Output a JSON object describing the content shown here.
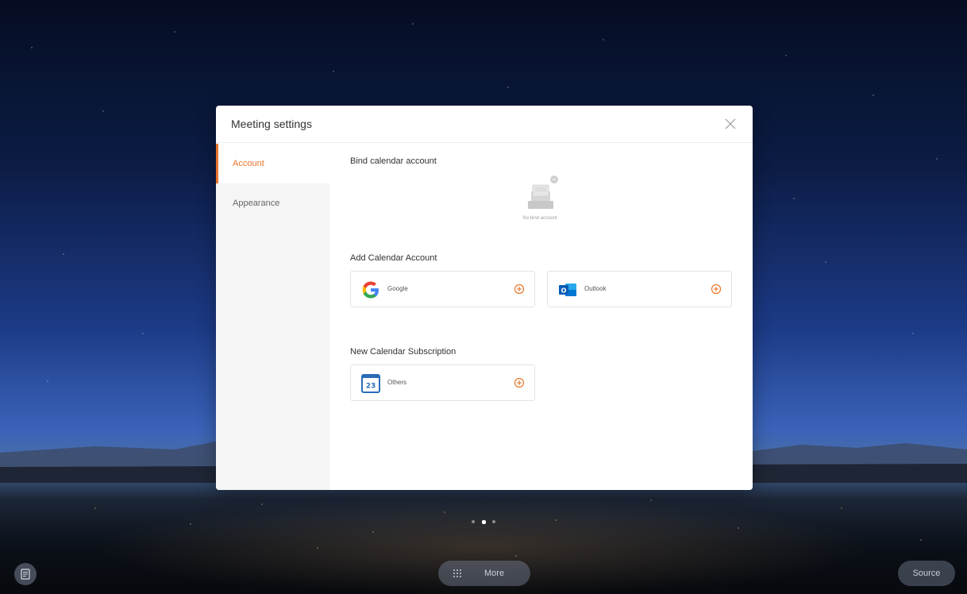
{
  "dialog": {
    "title": "Meeting settings"
  },
  "sidebar": {
    "items": [
      {
        "label": "Account",
        "active": true
      },
      {
        "label": "Appearance",
        "active": false
      }
    ]
  },
  "content": {
    "bind_title": "Bind calendar account",
    "empty_caption": "No bind account",
    "add_title": "Add Calendar Account",
    "accounts": [
      {
        "label": "Google",
        "icon": "google-logo-icon"
      },
      {
        "label": "Outlook",
        "icon": "outlook-logo-icon"
      }
    ],
    "subscription_title": "New Calendar Subscription",
    "subscriptions": [
      {
        "label": "Others",
        "icon": "calendar-23-icon",
        "calendar_number": "23"
      }
    ]
  },
  "taskbar": {
    "more_label": "More",
    "source_label": "Source",
    "pager": {
      "total": 3,
      "active_index": 1
    }
  },
  "colors": {
    "accent": "#e8762c",
    "dialog_bg": "#ffffff",
    "sidebar_bg": "#f5f5f5"
  }
}
